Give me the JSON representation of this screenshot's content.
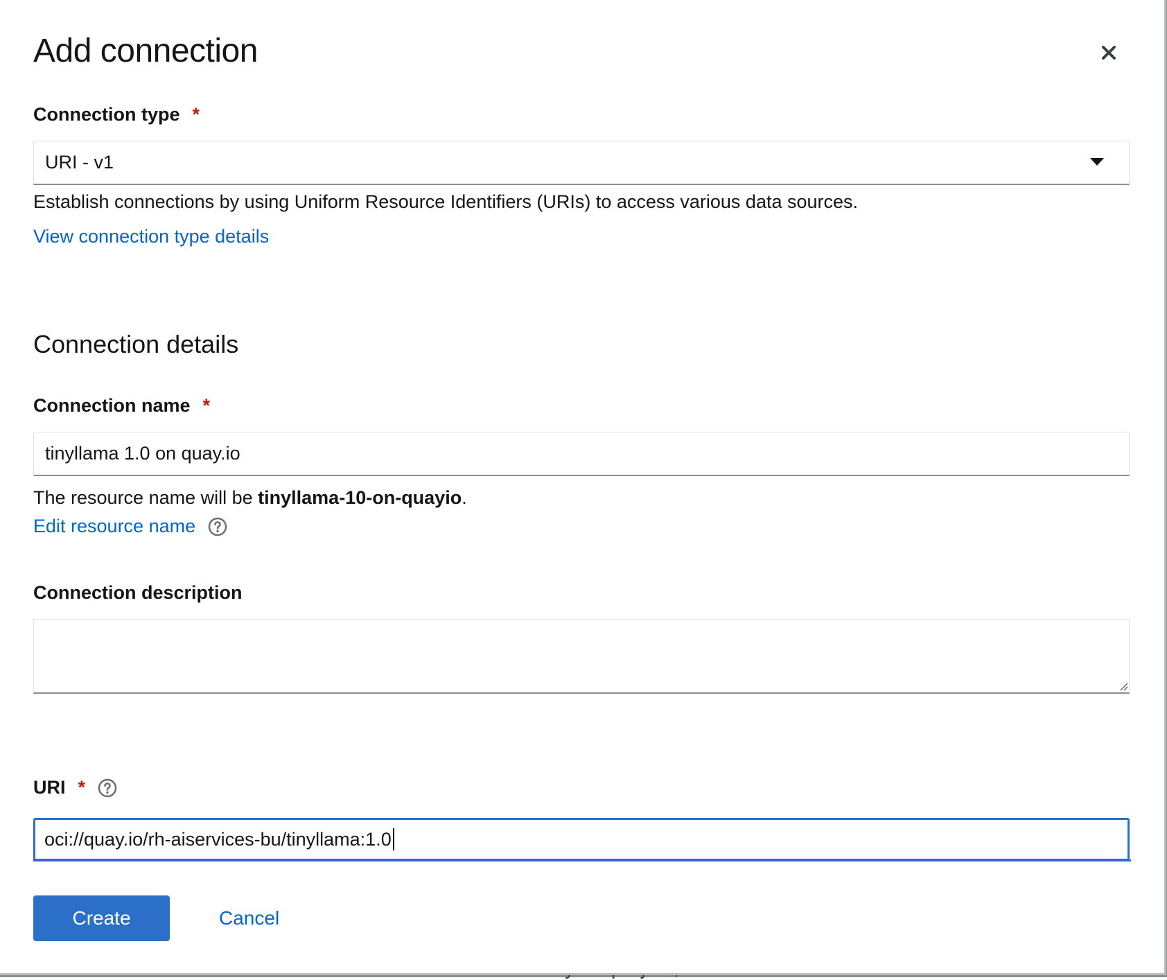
{
  "background_peek_text": "artifacts in your project, such as workbenches and model servers",
  "modal": {
    "title": "Add connection",
    "close_icon": "close-icon"
  },
  "connection_type": {
    "label": "Connection type",
    "required_marker": "*",
    "selected_value": "URI - v1",
    "description": "Establish connections by using Uniform Resource Identifiers (URIs) to access various data sources.",
    "details_link": "View connection type details"
  },
  "connection_details": {
    "section_title": "Connection details",
    "name": {
      "label": "Connection name",
      "required_marker": "*",
      "value": "tinyllama 1.0 on quay.io",
      "resource_prefix": "The resource name will be ",
      "resource_name": "tinyllama-10-on-quayio",
      "resource_suffix": ".",
      "edit_link": "Edit resource name",
      "help_icon": "help-icon"
    },
    "description": {
      "label": "Connection description",
      "value": ""
    },
    "uri": {
      "label": "URI",
      "required_marker": "*",
      "help_icon": "help-icon",
      "value": "oci://quay.io/rh-aiservices-bu/tinyllama:1.0"
    }
  },
  "actions": {
    "create_label": "Create",
    "cancel_label": "Cancel"
  },
  "colors": {
    "primary": "#2b6fc9",
    "link": "#0066cc",
    "required": "#c9190b",
    "text": "#151515"
  }
}
